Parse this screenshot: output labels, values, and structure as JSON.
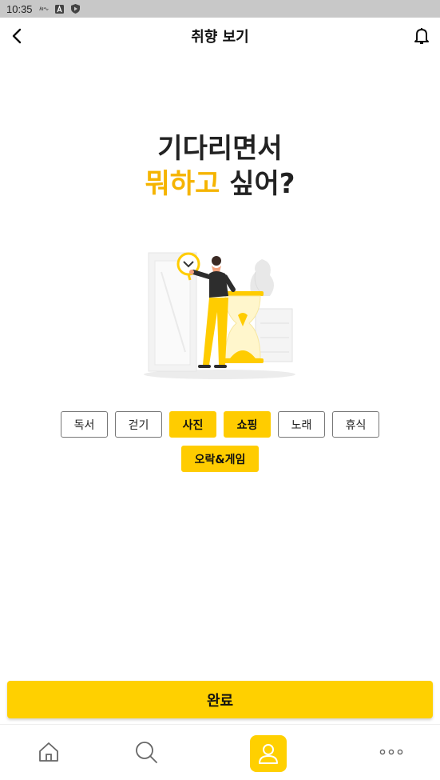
{
  "status_bar": {
    "time": "10:35"
  },
  "header": {
    "title": "취향 보기"
  },
  "headline": {
    "line1": "기다리면서",
    "accent": "뭐하고",
    "line2_rest": " 싶어?"
  },
  "chips": [
    {
      "label": "독서",
      "selected": false
    },
    {
      "label": "걷기",
      "selected": false
    },
    {
      "label": "사진",
      "selected": true
    },
    {
      "label": "쇼핑",
      "selected": true
    },
    {
      "label": "노래",
      "selected": false
    },
    {
      "label": "휴식",
      "selected": false
    },
    {
      "label": "오락&게임",
      "selected": true
    }
  ],
  "done_button": {
    "label": "완료"
  },
  "bottom_nav": [
    {
      "icon": "home-icon"
    },
    {
      "icon": "search-icon"
    },
    {
      "icon": "profile-icon",
      "active": true
    },
    {
      "icon": "more-icon"
    }
  ],
  "colors": {
    "accent": "#ffcc00",
    "accent_text": "#f5b400"
  }
}
